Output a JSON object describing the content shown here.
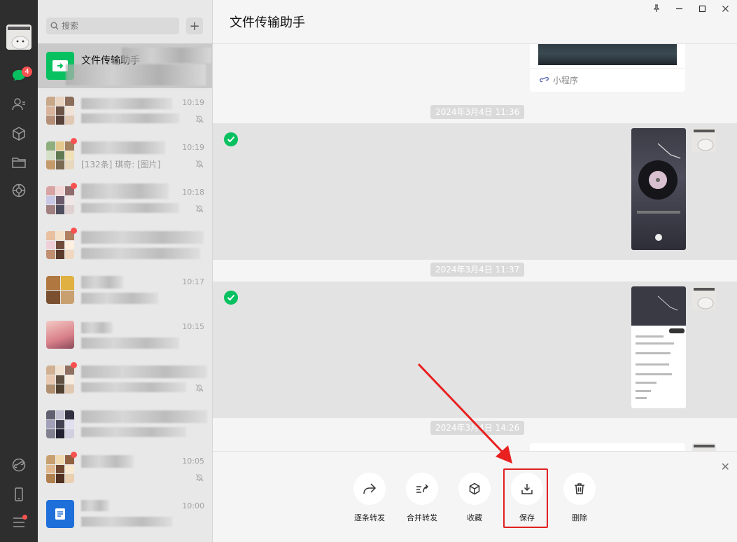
{
  "nav": {
    "unread_badge": "4",
    "icons": [
      "chat-icon",
      "contacts-icon",
      "cube-icon",
      "folder-icon",
      "moments-icon",
      "mini-program-icon",
      "phone-icon",
      "menu-icon"
    ]
  },
  "list": {
    "search_placeholder": "搜索",
    "add_label": "+",
    "items": [
      {
        "name": "文件传输助手",
        "time": "",
        "preview": ""
      },
      {
        "name": "",
        "time": "10:19",
        "preview": ""
      },
      {
        "name": "",
        "time": "10:19",
        "preview": "[132条] 琪奇: [图片]"
      },
      {
        "name": "",
        "time": "10:18",
        "preview": ""
      },
      {
        "name": "",
        "time": "",
        "preview": ""
      },
      {
        "name": "",
        "time": "10:17",
        "preview": ""
      },
      {
        "name": "",
        "time": "10:15",
        "preview": ""
      },
      {
        "name": "",
        "time": "",
        "preview": ""
      },
      {
        "name": "",
        "time": "",
        "preview": ""
      },
      {
        "name": "",
        "time": "10:05",
        "preview": ""
      },
      {
        "name": "",
        "time": "10:00",
        "preview": ""
      }
    ]
  },
  "chat": {
    "title": "文件传输助手",
    "mini_program_label": "小程序",
    "timestamps": [
      "2024年3月4日 11:36",
      "2024年3月4日 11:37",
      "2024年3月4日 14:26"
    ]
  },
  "actions": {
    "forward_one": "逐条转发",
    "forward_merge": "合并转发",
    "favorite": "收藏",
    "save": "保存",
    "delete": "删除",
    "close": "✕"
  },
  "colors": {
    "accent_green": "#07c160",
    "badge_red": "#fa5151",
    "highlight_red": "#e02020"
  }
}
